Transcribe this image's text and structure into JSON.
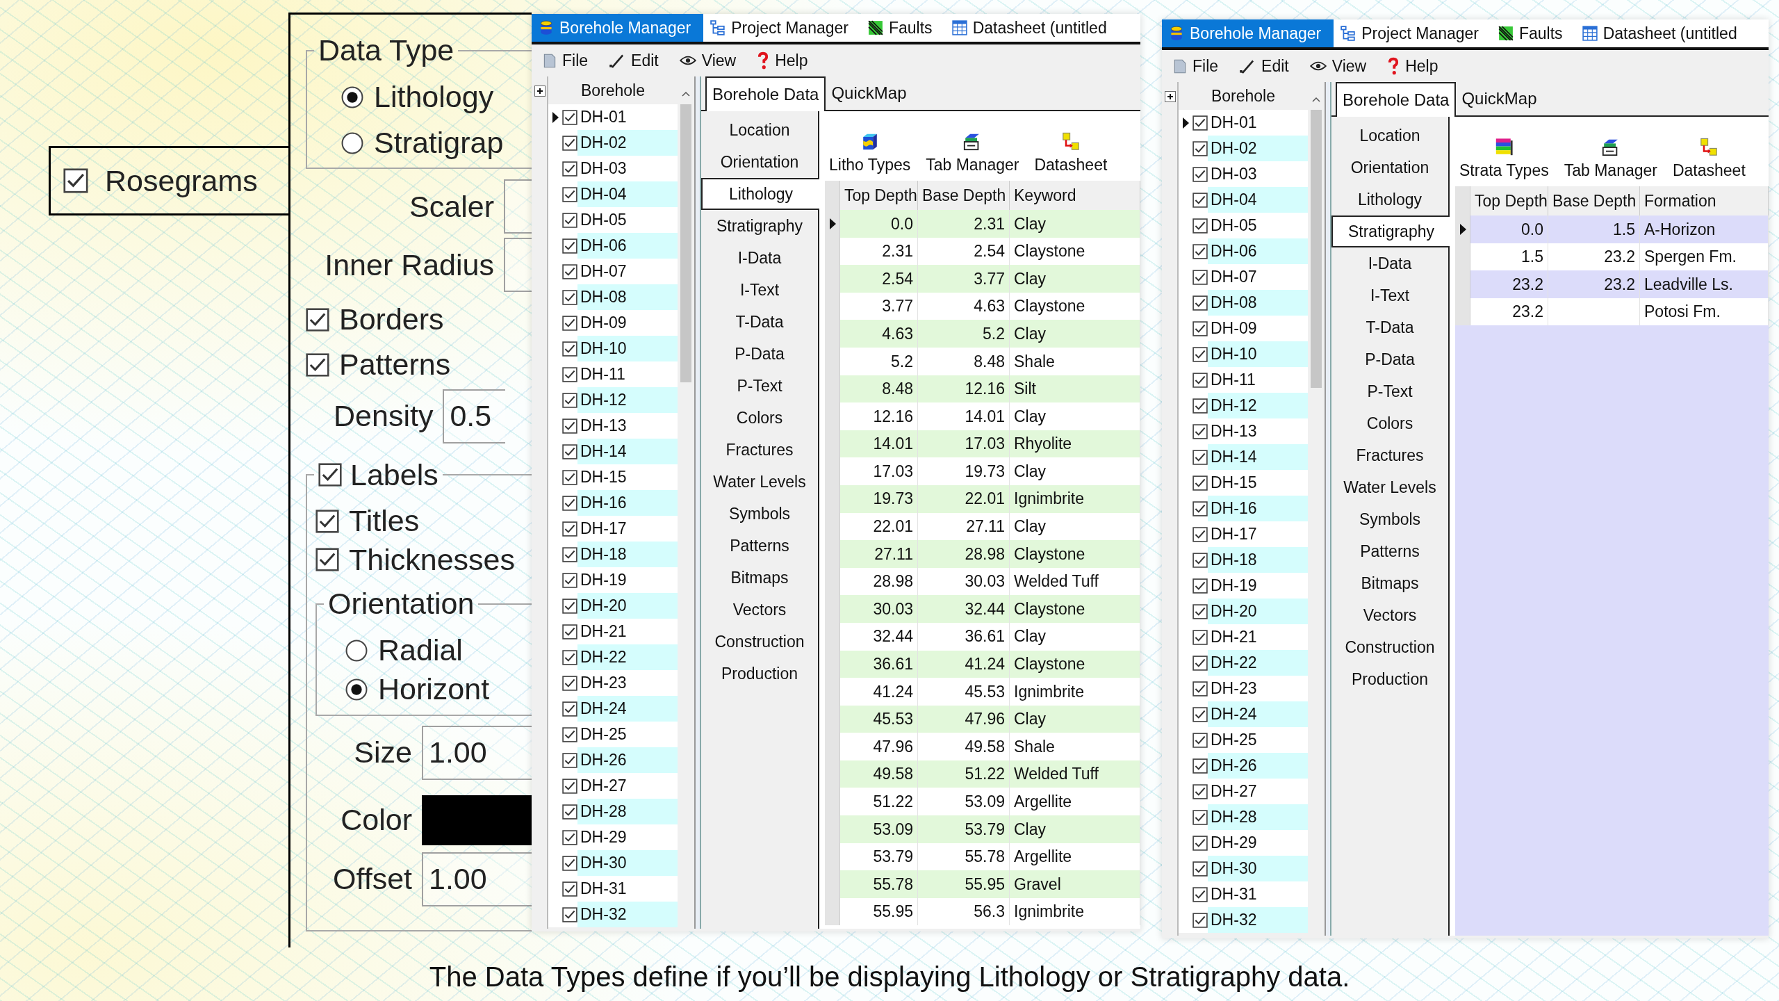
{
  "left_panel": {
    "data_type": {
      "title": "Data Type",
      "options": [
        {
          "label": "Lithology",
          "selected": true
        },
        {
          "label": "Stratigrap",
          "selected": false
        }
      ]
    },
    "rosegrams": {
      "label": "Rosegrams",
      "checked": true
    },
    "scaler": {
      "label": "Scaler"
    },
    "inner_radius": {
      "label": "Inner Radius"
    },
    "borders": {
      "label": "Borders",
      "checked": true
    },
    "patterns": {
      "label": "Patterns",
      "checked": true
    },
    "density": {
      "label": "Density",
      "value": "0.5"
    },
    "labels": {
      "label": "Labels",
      "checked": true,
      "titles": {
        "label": "Titles",
        "checked": true
      },
      "thicknesses": {
        "label": "Thicknesses",
        "checked": true
      },
      "orientation": {
        "title": "Orientation",
        "options": [
          {
            "label": "Radial",
            "selected": false
          },
          {
            "label": "Horizont",
            "selected": true
          }
        ]
      },
      "size": {
        "label": "Size",
        "value": "1.00"
      },
      "color": {
        "label": "Color",
        "color": "#000000"
      },
      "offset": {
        "label": "Offset",
        "value": "1.00"
      }
    }
  },
  "windows": [
    {
      "app_tabs": [
        {
          "label": "Borehole Manager",
          "kind": "borehole",
          "selected": true
        },
        {
          "label": "Project Manager",
          "kind": "tree",
          "selected": false
        },
        {
          "label": "Faults",
          "kind": "faults",
          "selected": false
        },
        {
          "label": "Datasheet (untitled",
          "kind": "grid",
          "selected": false
        }
      ],
      "menu": [
        {
          "label": "File",
          "kind": "file"
        },
        {
          "label": "Edit",
          "kind": "edit"
        },
        {
          "label": "View",
          "kind": "view"
        },
        {
          "label": "Help",
          "kind": "help"
        }
      ],
      "borehole_list": {
        "header": "Borehole",
        "items": [
          {
            "label": "DH-01",
            "checked": true,
            "selected": true
          },
          {
            "label": "DH-02",
            "checked": true,
            "selected": false
          },
          {
            "label": "DH-03",
            "checked": true,
            "selected": false
          },
          {
            "label": "DH-04",
            "checked": true,
            "selected": false
          },
          {
            "label": "DH-05",
            "checked": true,
            "selected": false
          },
          {
            "label": "DH-06",
            "checked": true,
            "selected": false
          },
          {
            "label": "DH-07",
            "checked": true,
            "selected": false
          },
          {
            "label": "DH-08",
            "checked": true,
            "selected": false
          },
          {
            "label": "DH-09",
            "checked": true,
            "selected": false
          },
          {
            "label": "DH-10",
            "checked": true,
            "selected": false
          },
          {
            "label": "DH-11",
            "checked": true,
            "selected": false
          },
          {
            "label": "DH-12",
            "checked": true,
            "selected": false
          },
          {
            "label": "DH-13",
            "checked": true,
            "selected": false
          },
          {
            "label": "DH-14",
            "checked": true,
            "selected": false
          },
          {
            "label": "DH-15",
            "checked": true,
            "selected": false
          },
          {
            "label": "DH-16",
            "checked": true,
            "selected": false
          },
          {
            "label": "DH-17",
            "checked": true,
            "selected": false
          },
          {
            "label": "DH-18",
            "checked": true,
            "selected": false
          },
          {
            "label": "DH-19",
            "checked": true,
            "selected": false
          },
          {
            "label": "DH-20",
            "checked": true,
            "selected": false
          },
          {
            "label": "DH-21",
            "checked": true,
            "selected": false
          },
          {
            "label": "DH-22",
            "checked": true,
            "selected": false
          },
          {
            "label": "DH-23",
            "checked": true,
            "selected": false
          },
          {
            "label": "DH-24",
            "checked": true,
            "selected": false
          },
          {
            "label": "DH-25",
            "checked": true,
            "selected": false
          },
          {
            "label": "DH-26",
            "checked": true,
            "selected": false
          },
          {
            "label": "DH-27",
            "checked": true,
            "selected": false
          },
          {
            "label": "DH-28",
            "checked": true,
            "selected": false
          },
          {
            "label": "DH-29",
            "checked": true,
            "selected": false
          },
          {
            "label": "DH-30",
            "checked": true,
            "selected": false
          },
          {
            "label": "DH-31",
            "checked": true,
            "selected": false
          },
          {
            "label": "DH-32",
            "checked": true,
            "selected": false
          }
        ]
      },
      "data_tabs": [
        {
          "label": "Borehole Data",
          "selected": true
        },
        {
          "label": "QuickMap",
          "selected": false
        }
      ],
      "side_tabs": [
        {
          "label": "Location",
          "selected": false
        },
        {
          "label": "Orientation",
          "selected": false
        },
        {
          "label": "Lithology",
          "selected": true
        },
        {
          "label": "Stratigraphy",
          "selected": false
        },
        {
          "label": "I-Data",
          "selected": false
        },
        {
          "label": "I-Text",
          "selected": false
        },
        {
          "label": "T-Data",
          "selected": false
        },
        {
          "label": "P-Data",
          "selected": false
        },
        {
          "label": "P-Text",
          "selected": false
        },
        {
          "label": "Colors",
          "selected": false
        },
        {
          "label": "Fractures",
          "selected": false
        },
        {
          "label": "Water Levels",
          "selected": false
        },
        {
          "label": "Symbols",
          "selected": false
        },
        {
          "label": "Patterns",
          "selected": false
        },
        {
          "label": "Bitmaps",
          "selected": false
        },
        {
          "label": "Vectors",
          "selected": false
        },
        {
          "label": "Construction",
          "selected": false
        },
        {
          "label": "Production",
          "selected": false
        }
      ],
      "toolbar": [
        {
          "label": "Litho Types",
          "kind": "litho"
        },
        {
          "label": "Tab Manager",
          "kind": "tabs"
        },
        {
          "label": "Datasheet",
          "kind": "sheet"
        }
      ],
      "table": {
        "kind": "lithology",
        "columns": [
          "Top Depth",
          "Base Depth",
          "Keyword"
        ],
        "rows": [
          {
            "cells": [
              "0.0",
              "2.31",
              "Clay"
            ],
            "selected": true
          },
          {
            "cells": [
              "2.31",
              "2.54",
              "Claystone"
            ],
            "selected": false
          },
          {
            "cells": [
              "2.54",
              "3.77",
              "Clay"
            ],
            "selected": false
          },
          {
            "cells": [
              "3.77",
              "4.63",
              "Claystone"
            ],
            "selected": false
          },
          {
            "cells": [
              "4.63",
              "5.2",
              "Clay"
            ],
            "selected": false
          },
          {
            "cells": [
              "5.2",
              "8.48",
              "Shale"
            ],
            "selected": false
          },
          {
            "cells": [
              "8.48",
              "12.16",
              "Silt"
            ],
            "selected": false
          },
          {
            "cells": [
              "12.16",
              "14.01",
              "Clay"
            ],
            "selected": false
          },
          {
            "cells": [
              "14.01",
              "17.03",
              "Rhyolite"
            ],
            "selected": false
          },
          {
            "cells": [
              "17.03",
              "19.73",
              "Clay"
            ],
            "selected": false
          },
          {
            "cells": [
              "19.73",
              "22.01",
              "Ignimbrite"
            ],
            "selected": false
          },
          {
            "cells": [
              "22.01",
              "27.11",
              "Clay"
            ],
            "selected": false
          },
          {
            "cells": [
              "27.11",
              "28.98",
              "Claystone"
            ],
            "selected": false
          },
          {
            "cells": [
              "28.98",
              "30.03",
              "Welded Tuff"
            ],
            "selected": false
          },
          {
            "cells": [
              "30.03",
              "32.44",
              "Claystone"
            ],
            "selected": false
          },
          {
            "cells": [
              "32.44",
              "36.61",
              "Clay"
            ],
            "selected": false
          },
          {
            "cells": [
              "36.61",
              "41.24",
              "Claystone"
            ],
            "selected": false
          },
          {
            "cells": [
              "41.24",
              "45.53",
              "Ignimbrite"
            ],
            "selected": false
          },
          {
            "cells": [
              "45.53",
              "47.96",
              "Clay"
            ],
            "selected": false
          },
          {
            "cells": [
              "47.96",
              "49.58",
              "Shale"
            ],
            "selected": false
          },
          {
            "cells": [
              "49.58",
              "51.22",
              "Welded Tuff"
            ],
            "selected": false
          },
          {
            "cells": [
              "51.22",
              "53.09",
              "Argellite"
            ],
            "selected": false
          },
          {
            "cells": [
              "53.09",
              "53.79",
              "Clay"
            ],
            "selected": false
          },
          {
            "cells": [
              "53.79",
              "55.78",
              "Argellite"
            ],
            "selected": false
          },
          {
            "cells": [
              "55.78",
              "55.95",
              "Gravel"
            ],
            "selected": false
          },
          {
            "cells": [
              "55.95",
              "56.3",
              "Ignimbrite"
            ],
            "selected": false
          }
        ]
      }
    },
    {
      "app_tabs": [
        {
          "label": "Borehole Manager",
          "kind": "borehole",
          "selected": true
        },
        {
          "label": "Project Manager",
          "kind": "tree",
          "selected": false
        },
        {
          "label": "Faults",
          "kind": "faults",
          "selected": false
        },
        {
          "label": "Datasheet (untitled",
          "kind": "grid",
          "selected": false
        }
      ],
      "menu": [
        {
          "label": "File",
          "kind": "file"
        },
        {
          "label": "Edit",
          "kind": "edit"
        },
        {
          "label": "View",
          "kind": "view"
        },
        {
          "label": "Help",
          "kind": "help"
        }
      ],
      "borehole_list": {
        "header": "Borehole",
        "items": [
          {
            "label": "DH-01",
            "checked": true,
            "selected": true
          },
          {
            "label": "DH-02",
            "checked": true,
            "selected": false
          },
          {
            "label": "DH-03",
            "checked": true,
            "selected": false
          },
          {
            "label": "DH-04",
            "checked": true,
            "selected": false
          },
          {
            "label": "DH-05",
            "checked": true,
            "selected": false
          },
          {
            "label": "DH-06",
            "checked": true,
            "selected": false
          },
          {
            "label": "DH-07",
            "checked": true,
            "selected": false
          },
          {
            "label": "DH-08",
            "checked": true,
            "selected": false
          },
          {
            "label": "DH-09",
            "checked": true,
            "selected": false
          },
          {
            "label": "DH-10",
            "checked": true,
            "selected": false
          },
          {
            "label": "DH-11",
            "checked": true,
            "selected": false
          },
          {
            "label": "DH-12",
            "checked": true,
            "selected": false
          },
          {
            "label": "DH-13",
            "checked": true,
            "selected": false
          },
          {
            "label": "DH-14",
            "checked": true,
            "selected": false
          },
          {
            "label": "DH-15",
            "checked": true,
            "selected": false
          },
          {
            "label": "DH-16",
            "checked": true,
            "selected": false
          },
          {
            "label": "DH-17",
            "checked": true,
            "selected": false
          },
          {
            "label": "DH-18",
            "checked": true,
            "selected": false
          },
          {
            "label": "DH-19",
            "checked": true,
            "selected": false
          },
          {
            "label": "DH-20",
            "checked": true,
            "selected": false
          },
          {
            "label": "DH-21",
            "checked": true,
            "selected": false
          },
          {
            "label": "DH-22",
            "checked": true,
            "selected": false
          },
          {
            "label": "DH-23",
            "checked": true,
            "selected": false
          },
          {
            "label": "DH-24",
            "checked": true,
            "selected": false
          },
          {
            "label": "DH-25",
            "checked": true,
            "selected": false
          },
          {
            "label": "DH-26",
            "checked": true,
            "selected": false
          },
          {
            "label": "DH-27",
            "checked": true,
            "selected": false
          },
          {
            "label": "DH-28",
            "checked": true,
            "selected": false
          },
          {
            "label": "DH-29",
            "checked": true,
            "selected": false
          },
          {
            "label": "DH-30",
            "checked": true,
            "selected": false
          },
          {
            "label": "DH-31",
            "checked": true,
            "selected": false
          },
          {
            "label": "DH-32",
            "checked": true,
            "selected": false
          }
        ]
      },
      "data_tabs": [
        {
          "label": "Borehole Data",
          "selected": true
        },
        {
          "label": "QuickMap",
          "selected": false
        }
      ],
      "side_tabs": [
        {
          "label": "Location",
          "selected": false
        },
        {
          "label": "Orientation",
          "selected": false
        },
        {
          "label": "Lithology",
          "selected": false
        },
        {
          "label": "Stratigraphy",
          "selected": true
        },
        {
          "label": "I-Data",
          "selected": false
        },
        {
          "label": "I-Text",
          "selected": false
        },
        {
          "label": "T-Data",
          "selected": false
        },
        {
          "label": "P-Data",
          "selected": false
        },
        {
          "label": "P-Text",
          "selected": false
        },
        {
          "label": "Colors",
          "selected": false
        },
        {
          "label": "Fractures",
          "selected": false
        },
        {
          "label": "Water Levels",
          "selected": false
        },
        {
          "label": "Symbols",
          "selected": false
        },
        {
          "label": "Patterns",
          "selected": false
        },
        {
          "label": "Bitmaps",
          "selected": false
        },
        {
          "label": "Vectors",
          "selected": false
        },
        {
          "label": "Construction",
          "selected": false
        },
        {
          "label": "Production",
          "selected": false
        }
      ],
      "toolbar": [
        {
          "label": "Strata Types",
          "kind": "strata"
        },
        {
          "label": "Tab Manager",
          "kind": "tabs"
        },
        {
          "label": "Datasheet",
          "kind": "sheet"
        }
      ],
      "table": {
        "kind": "stratigraphy",
        "columns": [
          "Top Depth",
          "Base Depth",
          "Formation"
        ],
        "rows": [
          {
            "cells": [
              "0.0",
              "1.5",
              "A-Horizon"
            ],
            "selected": true
          },
          {
            "cells": [
              "1.5",
              "23.2",
              "Spergen Fm."
            ],
            "selected": false
          },
          {
            "cells": [
              "23.2",
              "23.2",
              "Leadville Ls."
            ],
            "selected": false
          },
          {
            "cells": [
              "23.2",
              null,
              "Potosi Fm."
            ],
            "selected": false
          }
        ]
      }
    }
  ],
  "caption": "The Data Types define if you’ll be displaying Lithology or Stratigraphy data."
}
